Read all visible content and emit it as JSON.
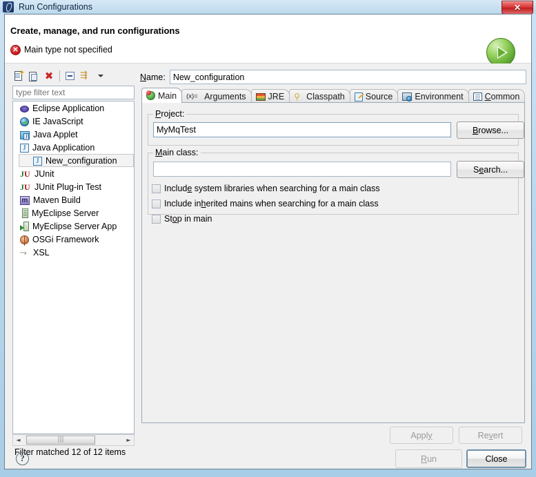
{
  "window": {
    "title": "Run Configurations",
    "icon": "eclipse-run-icon",
    "close_label": "✕"
  },
  "header": {
    "title": "Create, manage, and run configurations",
    "message": "Main type not specified",
    "error_icon": "error-x-icon",
    "run_icon": "run-play-icon",
    "error_color": "#cf1f20"
  },
  "left": {
    "toolbar": [
      {
        "name": "new-configuration-button",
        "icon": "new-document-icon"
      },
      {
        "name": "duplicate-configuration-button",
        "icon": "duplicate-document-icon"
      },
      {
        "name": "delete-configuration-button",
        "icon": "delete-x-icon"
      },
      {
        "name": "collapse-all-button",
        "icon": "collapse-all-icon"
      },
      {
        "name": "filter-button",
        "icon": "filter-icon"
      },
      {
        "name": "view-menu-button",
        "icon": "chevron-down-icon"
      }
    ],
    "filter": {
      "value": "",
      "placeholder": "type filter text"
    },
    "tree": [
      {
        "label": "Eclipse Application",
        "icon": "eclipse-application-icon",
        "child": false,
        "selected": false
      },
      {
        "label": "IE JavaScript",
        "icon": "ie-javascript-icon",
        "child": false,
        "selected": false
      },
      {
        "label": "Java Applet",
        "icon": "java-applet-icon",
        "child": false,
        "selected": false
      },
      {
        "label": "Java Application",
        "icon": "java-application-icon",
        "child": false,
        "selected": false
      },
      {
        "label": "New_configuration",
        "icon": "java-application-icon",
        "child": true,
        "selected": true
      },
      {
        "label": "JUnit",
        "icon": "junit-icon",
        "child": false,
        "selected": false
      },
      {
        "label": "JUnit Plug-in Test",
        "icon": "junit-plugin-icon",
        "child": false,
        "selected": false
      },
      {
        "label": "Maven Build",
        "icon": "maven-icon",
        "child": false,
        "selected": false
      },
      {
        "label": "MyEclipse Server",
        "icon": "server-icon",
        "child": false,
        "selected": false
      },
      {
        "label": "MyEclipse Server App",
        "icon": "server-app-icon",
        "child": false,
        "selected": false
      },
      {
        "label": "OSGi Framework",
        "icon": "osgi-icon",
        "child": false,
        "selected": false
      },
      {
        "label": "XSL",
        "icon": "xsl-icon",
        "child": false,
        "selected": false
      }
    ],
    "scroll": {
      "left_arrow": "◄",
      "right_arrow": "►",
      "thumb_grip": "|||"
    },
    "status": "Filter matched 12 of 12 items"
  },
  "right": {
    "name_label": "Name:",
    "name_label_mnemonic": "N",
    "name_label_rest": "ame:",
    "name_value": "New_configuration",
    "tabs": [
      {
        "label": "Main",
        "icon": "main-tab-icon",
        "active": true,
        "mnemonic": "",
        "rest": "Main"
      },
      {
        "label": "Arguments",
        "icon": "arguments-tab-icon",
        "active": false,
        "prefix": "(x)=",
        "rest": "Arguments"
      },
      {
        "label": "JRE",
        "icon": "jre-tab-icon",
        "active": false,
        "rest": "JRE"
      },
      {
        "label": "Classpath",
        "icon": "classpath-tab-icon",
        "active": false,
        "rest": "Classpath"
      },
      {
        "label": "Source",
        "icon": "source-tab-icon",
        "active": false,
        "rest": "Source"
      },
      {
        "label": "Environment",
        "icon": "environment-tab-icon",
        "active": false,
        "rest": "Environment"
      },
      {
        "label": "Common",
        "icon": "common-tab-icon",
        "active": false,
        "mnemonic": "C",
        "rest": "ommon"
      }
    ],
    "main_tab": {
      "project_group_label": "Project:",
      "project_mnemonic": "P",
      "project_label_rest": "roject:",
      "project_value": "MyMqTest",
      "browse_button": "Browse...",
      "browse_mnemonic": "B",
      "browse_rest": "rowse...",
      "mainclass_group_label": "Main class:",
      "mainclass_mnemonic": "M",
      "mainclass_label_rest": "ain class:",
      "mainclass_value": "",
      "search_button": "Search...",
      "search_prefix": "S",
      "search_mnemonic": "e",
      "search_rest": "arch...",
      "checkboxes": [
        {
          "label": "Include system libraries when searching for a main class",
          "pre": "Includ",
          "mn": "e",
          "post": " system libraries when searching for a main class",
          "checked": false
        },
        {
          "label": "Include inherited mains when searching for a main class",
          "pre": "Include in",
          "mn": "h",
          "post": "erited mains when searching for a main class",
          "checked": false
        },
        {
          "label": "Stop in main",
          "pre": "St",
          "mn": "o",
          "post": "p in main",
          "checked": false
        }
      ]
    },
    "apply_button": "Apply",
    "apply_pre": "Appl",
    "apply_mn": "y",
    "revert_button": "Revert",
    "revert_pre": "Re",
    "revert_mn": "v",
    "revert_post": "ert"
  },
  "footer": {
    "help_icon": "help-question-icon",
    "run_button": "Run",
    "run_mn": "R",
    "run_rest": "un",
    "close_button": "Close"
  }
}
